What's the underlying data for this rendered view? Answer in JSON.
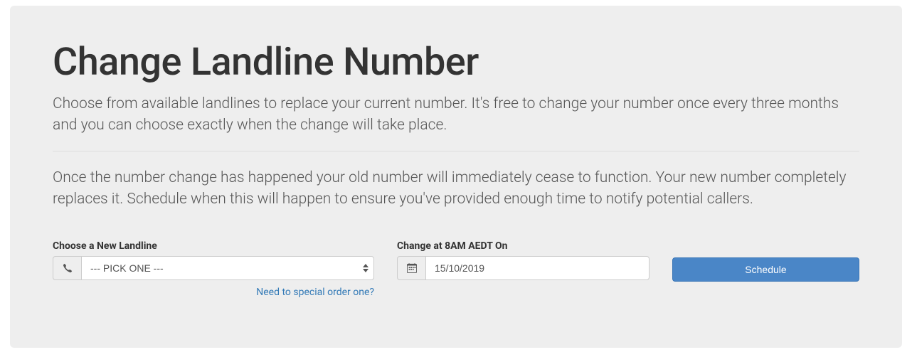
{
  "header": {
    "title": "Change Landline Number",
    "lead": "Choose from available landlines to replace your current number. It's free to change your number once every three months and you can choose exactly when the change will take place.",
    "info": "Once the number change has happened your old number will immediately cease to function. Your new number completely replaces it. Schedule when this will happen to ensure you've provided enough time to notify potential callers."
  },
  "form": {
    "landline": {
      "label": "Choose a New Landline",
      "selected": "--- PICK ONE ---",
      "help_link": "Need to special order one?"
    },
    "date": {
      "label": "Change at 8AM AEDT On",
      "value": "15/10/2019"
    },
    "submit": {
      "label": "Schedule"
    }
  }
}
